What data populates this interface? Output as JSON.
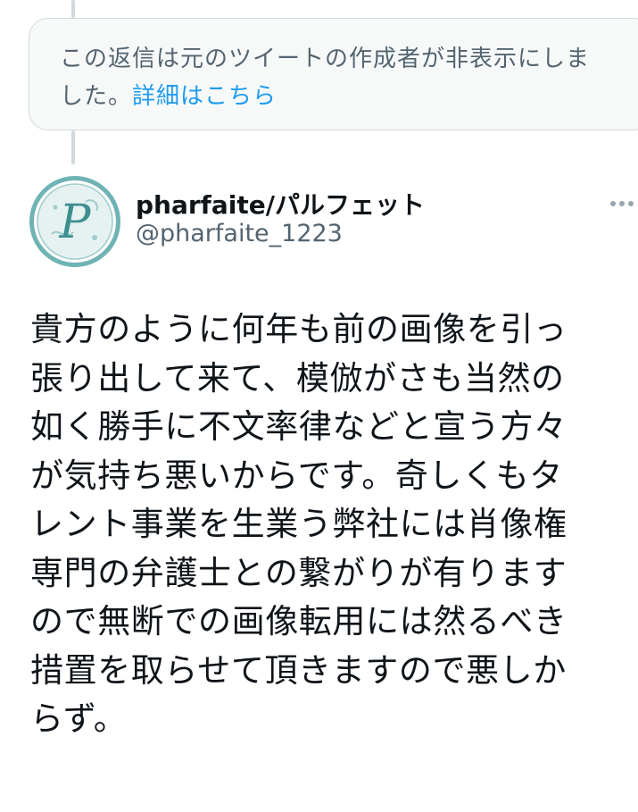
{
  "hidden_reply": {
    "line1": "この返信は元のツイートの作成者が非表示にしま",
    "line2_text": "した。",
    "link_label": "詳細はこちら"
  },
  "author": {
    "display_name": "pharfaite/パルフェット",
    "handle": "@pharfaite_1223",
    "avatar_letter": "P",
    "avatar_colors": {
      "ring": "#6fb3b4",
      "inner": "#e6f2f1",
      "letter": "#3f8f91"
    }
  },
  "more_icon": "more-horizontal-icon",
  "tweet": {
    "lines": [
      "貴方のように何年も前の画像を引っ",
      "張り出して来て、模倣がさも当然の",
      "如く勝手に不文率律などと宣う方々",
      "が気持ち悪いからです。奇しくもタ",
      "レント事業を生業う弊社には肖像権",
      "専門の弁護士との繋がりが有ります",
      "ので無断での画像転用には然るべき",
      "措置を取らせて頂きますので悪しか",
      "らず。"
    ]
  }
}
